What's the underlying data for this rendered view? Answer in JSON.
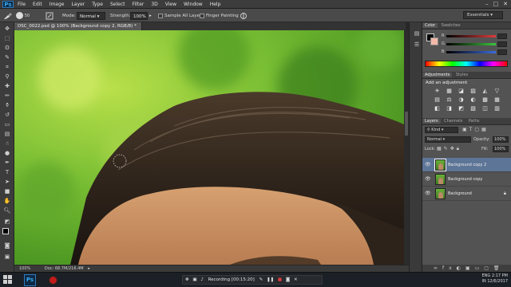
{
  "app": {
    "logo": "Ps",
    "menu": [
      "File",
      "Edit",
      "Image",
      "Layer",
      "Type",
      "Select",
      "Filter",
      "3D",
      "View",
      "Window",
      "Help"
    ],
    "window_controls": [
      "–",
      "□",
      "✕"
    ]
  },
  "options_bar": {
    "brush_size": "50",
    "mode_label": "Mode:",
    "mode_value": "Normal",
    "strength_label": "Strength:",
    "strength_value": "100%",
    "sample_all_layers": "Sample All Layers",
    "finger_painting": "Finger Painting",
    "workspace": "Essentials"
  },
  "document": {
    "tab_title": "DSC_0022.psd @ 100% (Background copy 2, RGB/8) *",
    "zoom": "100%",
    "doc_info": "Doc: 68.7M/216.4M"
  },
  "color_panel": {
    "tabs": [
      "Color",
      "Swatches"
    ],
    "channels": [
      {
        "label": "R",
        "value": "",
        "color": "#e03c3c"
      },
      {
        "label": "G",
        "value": "",
        "color": "#3cc43c"
      },
      {
        "label": "B",
        "value": "",
        "color": "#3c6ce0"
      }
    ]
  },
  "adjustments_panel": {
    "tabs": [
      "Adjustments",
      "Styles"
    ],
    "heading": "Add an adjustment",
    "icons": [
      "☀",
      "▦",
      "◪",
      "▨",
      "◭",
      "▽",
      "▤",
      "⚖",
      "◑",
      "◐",
      "▩",
      "▦",
      "◧",
      "◨",
      "◩",
      "▧",
      "◫",
      "▥"
    ]
  },
  "layers_panel": {
    "tabs": [
      "Layers",
      "Channels",
      "Paths"
    ],
    "kind_label": "Kind",
    "blend_mode": "Normal",
    "opacity_label": "Opacity:",
    "opacity_value": "100%",
    "lock_label": "Lock:",
    "fill_label": "Fill:",
    "fill_value": "100%",
    "layers": [
      {
        "name": "Background copy 2",
        "selected": true
      },
      {
        "name": "Background copy",
        "selected": false
      },
      {
        "name": "Background",
        "selected": false,
        "locked": true
      }
    ]
  },
  "recording_bar": {
    "label": "Recording [00:15:20]"
  },
  "taskbar": {
    "language": "ENG",
    "region": "IN",
    "time": "2:17 PM",
    "date": "12/6/2017"
  }
}
